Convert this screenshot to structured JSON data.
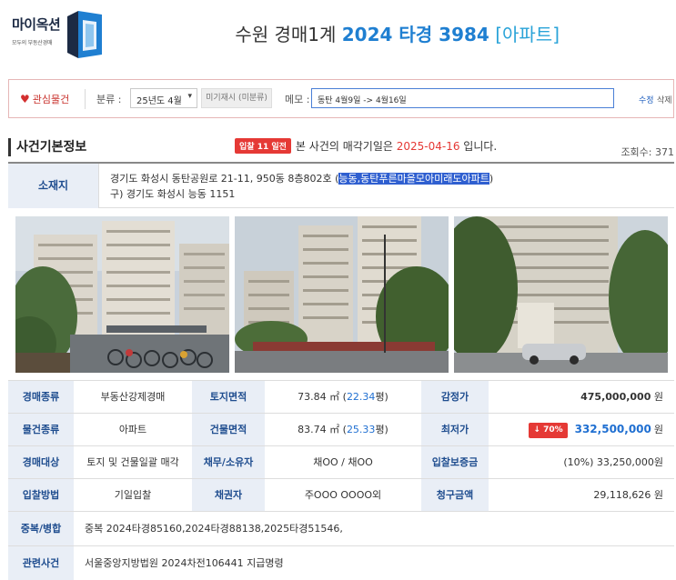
{
  "logo": {
    "title": "마이옥션",
    "subtitle": "모두의 부동산경매",
    "brand_color": "#1c2a44",
    "accent_color": "#1f7fd1"
  },
  "header": {
    "court": "수원 경매1계",
    "case_no": "2024 타경 3984",
    "property_type": "[아파트]"
  },
  "memo_bar": {
    "favorite_label": "관심물건",
    "category_label": "분류 :",
    "category_value": "25년도 4월",
    "unclassified_label": "미기재시 (미분류)",
    "memo_label": "메모 :",
    "memo_value": "동탄 4월9일 -> 4월16일",
    "edit_label": "수정",
    "delete_label": "삭제"
  },
  "section": {
    "title": "사건기본정보",
    "notice_badge": "입찰 11 일전",
    "notice_prefix": "본 사건의 매각기일은 ",
    "notice_date": "2025-04-16",
    "notice_suffix": " 입니다.",
    "view_count": "조회수: 371"
  },
  "address": {
    "label": "소재지",
    "line1_prefix": "경기도 화성시 동탄공원로 21-11, 950동 8층802호 (",
    "line1_highlight": "능동,동탄푸른마을모아미래도아파트",
    "line1_suffix": ")",
    "line2": "구) 경기도 화성시 능동 1151"
  },
  "photos": [
    "apartment-photo-1",
    "apartment-photo-2",
    "apartment-photo-3"
  ],
  "info": {
    "auction_type_label": "경매종류",
    "auction_type": "부동산강제경매",
    "land_area_label": "토지면적",
    "land_area_m2": "73.84 ㎡",
    "land_area_pyeong": "22.34",
    "appraisal_label": "감정가",
    "appraisal_value": "475,000,000",
    "won": "원",
    "property_type_label": "물건종류",
    "property_type": "아파트",
    "building_area_label": "건물면적",
    "building_area_m2": "83.74 ㎡",
    "building_area_pyeong": "25.33",
    "min_price_label": "최저가",
    "min_price_drop": "↓ 70%",
    "min_price_value": "332,500,000",
    "target_label": "경매대상",
    "target": "토지 및 건물일괄 매각",
    "debtor_label": "채무/소유자",
    "debtor": "채OO / 채OO",
    "deposit_label": "입찰보증금",
    "deposit": "(10%) 33,250,000원",
    "bid_method_label": "입찰방법",
    "bid_method": "기일입찰",
    "creditor_label": "채권자",
    "creditor": "주OOO OOOO외",
    "claim_label": "청구금액",
    "claim": "29,118,626 원",
    "duplicate_label": "중복/병합",
    "duplicate": "중복 2024타경85160,2024타경88138,2025타경51546,",
    "related_label": "관련사건",
    "related": "서울중앙지방법원 2024차전106441 지급명령"
  },
  "colors": {
    "label_bg": "#e9eef6",
    "label_text": "#1f4d8f",
    "accent_red": "#e53935",
    "accent_blue": "#1f6fd1"
  }
}
